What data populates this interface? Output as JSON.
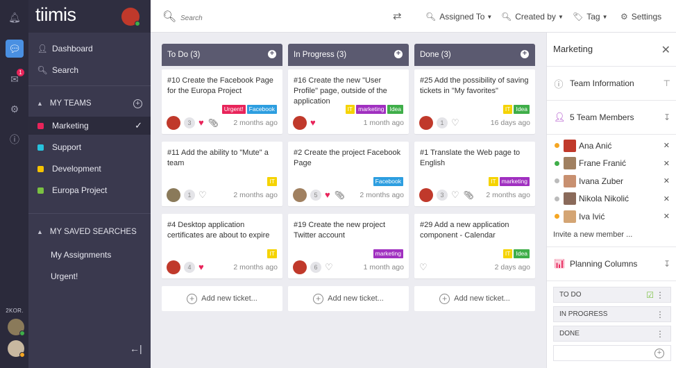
{
  "sidebar": {
    "logo": "tiimis",
    "nav": [
      {
        "label": "Dashboard",
        "icon": "dashboard-icon"
      },
      {
        "label": "Search",
        "icon": "search-icon"
      }
    ],
    "teams_section": "MY TEAMS",
    "teams": [
      {
        "label": "Marketing",
        "color": "#e8245a",
        "active": true
      },
      {
        "label": "Support",
        "color": "#27c2dd"
      },
      {
        "label": "Development",
        "color": "#f5c300"
      },
      {
        "label": "Europa Project",
        "color": "#7ac142"
      }
    ],
    "saved_section": "MY SAVED SEARCHES",
    "saved": [
      "My Assignments",
      "Urgent!"
    ]
  },
  "rail": {
    "user_label": "2KOR.",
    "notification_badge": "1"
  },
  "topbar": {
    "search_placeholder": "Search",
    "assigned_to": "Assigned To",
    "created_by": "Created by",
    "tag": "Tag",
    "settings": "Settings"
  },
  "columns": [
    {
      "title": "To Do (3)",
      "cards": [
        {
          "title": "#10  Create the Facebook Page for the Europa Project",
          "tags": [
            {
              "t": "Urgent!",
              "c": "#e8245a"
            },
            {
              "t": "Facebook",
              "c": "#2d9ee0"
            }
          ],
          "count": "3",
          "liked": true,
          "clip": true,
          "date": "2 months ago",
          "avatar": "#c0392b"
        },
        {
          "title": "#11  Add the ability to \"Mute\" a team",
          "tags": [
            {
              "t": "IT",
              "c": "#f5d300"
            }
          ],
          "count": "1",
          "liked": false,
          "clip": false,
          "date": "2 months ago",
          "avatar": "#8a7a5a"
        },
        {
          "title": "#4  Desktop application certificates are about to expire",
          "tags": [
            {
              "t": "IT",
              "c": "#f5d300"
            }
          ],
          "count": "4",
          "liked": true,
          "clip": false,
          "date": "2 months ago",
          "avatar": "#c0392b"
        }
      ],
      "add": "Add new ticket..."
    },
    {
      "title": "In Progress (3)",
      "cards": [
        {
          "title": "#16  Create the new \"User Profile\" page, outside of the application",
          "tags": [
            {
              "t": "IT",
              "c": "#f5d300"
            },
            {
              "t": "marketing",
              "c": "#a030c0"
            },
            {
              "t": "Idea",
              "c": "#3fae49"
            }
          ],
          "count": "",
          "liked": true,
          "clip": false,
          "date": "1 month ago",
          "avatar": "#c0392b"
        },
        {
          "title": "#2  Create the project Facebook Page",
          "tags": [
            {
              "t": "Facebook",
              "c": "#2d9ee0"
            }
          ],
          "count": "5",
          "liked": true,
          "clip": true,
          "date": "2 months ago",
          "avatar": "#a08060"
        },
        {
          "title": "#19  Create the new project Twitter account",
          "tags": [
            {
              "t": "marketing",
              "c": "#a030c0"
            }
          ],
          "count": "6",
          "liked": false,
          "clip": false,
          "date": "1 month ago",
          "avatar": "#c0392b"
        }
      ],
      "add": "Add new ticket..."
    },
    {
      "title": "Done (3)",
      "cards": [
        {
          "title": "#25  Add the possibility of saving tickets in \"My favorites\"",
          "tags": [
            {
              "t": "IT",
              "c": "#f5d300"
            },
            {
              "t": "Idea",
              "c": "#3fae49"
            }
          ],
          "count": "1",
          "liked": false,
          "clip": false,
          "date": "16 days ago",
          "avatar": "#c0392b"
        },
        {
          "title": "#1  Translate the Web page to English",
          "tags": [
            {
              "t": "IT",
              "c": "#f5d300"
            },
            {
              "t": "marketing",
              "c": "#a030c0"
            }
          ],
          "count": "3",
          "liked": false,
          "clip": true,
          "date": "2 months ago",
          "avatar": "#c0392b"
        },
        {
          "title": "#29  Add a new application component - Calendar",
          "tags": [
            {
              "t": "IT",
              "c": "#f5d300"
            },
            {
              "t": "Idea",
              "c": "#3fae49"
            }
          ],
          "count": "",
          "liked": false,
          "clip": false,
          "date": "2 days ago",
          "avatar": ""
        }
      ],
      "add": "Add new ticket..."
    }
  ],
  "panel": {
    "title": "Marketing",
    "team_info": "Team Information",
    "members_label": "5 Team Members",
    "members": [
      {
        "name": "Ana Anić",
        "status": "#f5a623",
        "avatar": "#c0392b"
      },
      {
        "name": "Frane Franić",
        "status": "#3fae49",
        "avatar": "#a08060"
      },
      {
        "name": "Ivana Zuber",
        "status": "#bbbbbb",
        "avatar": "#c89070"
      },
      {
        "name": "Nikola Nikolić",
        "status": "#bbbbbb",
        "avatar": "#8a6a5a"
      },
      {
        "name": "Iva Ivić",
        "status": "#f5a623",
        "avatar": "#d4a574"
      }
    ],
    "invite": "Invite a new member ...",
    "planning_label": "Planning Columns",
    "planning_columns": [
      "TO DO",
      "IN PROGRESS",
      "DONE"
    ]
  }
}
